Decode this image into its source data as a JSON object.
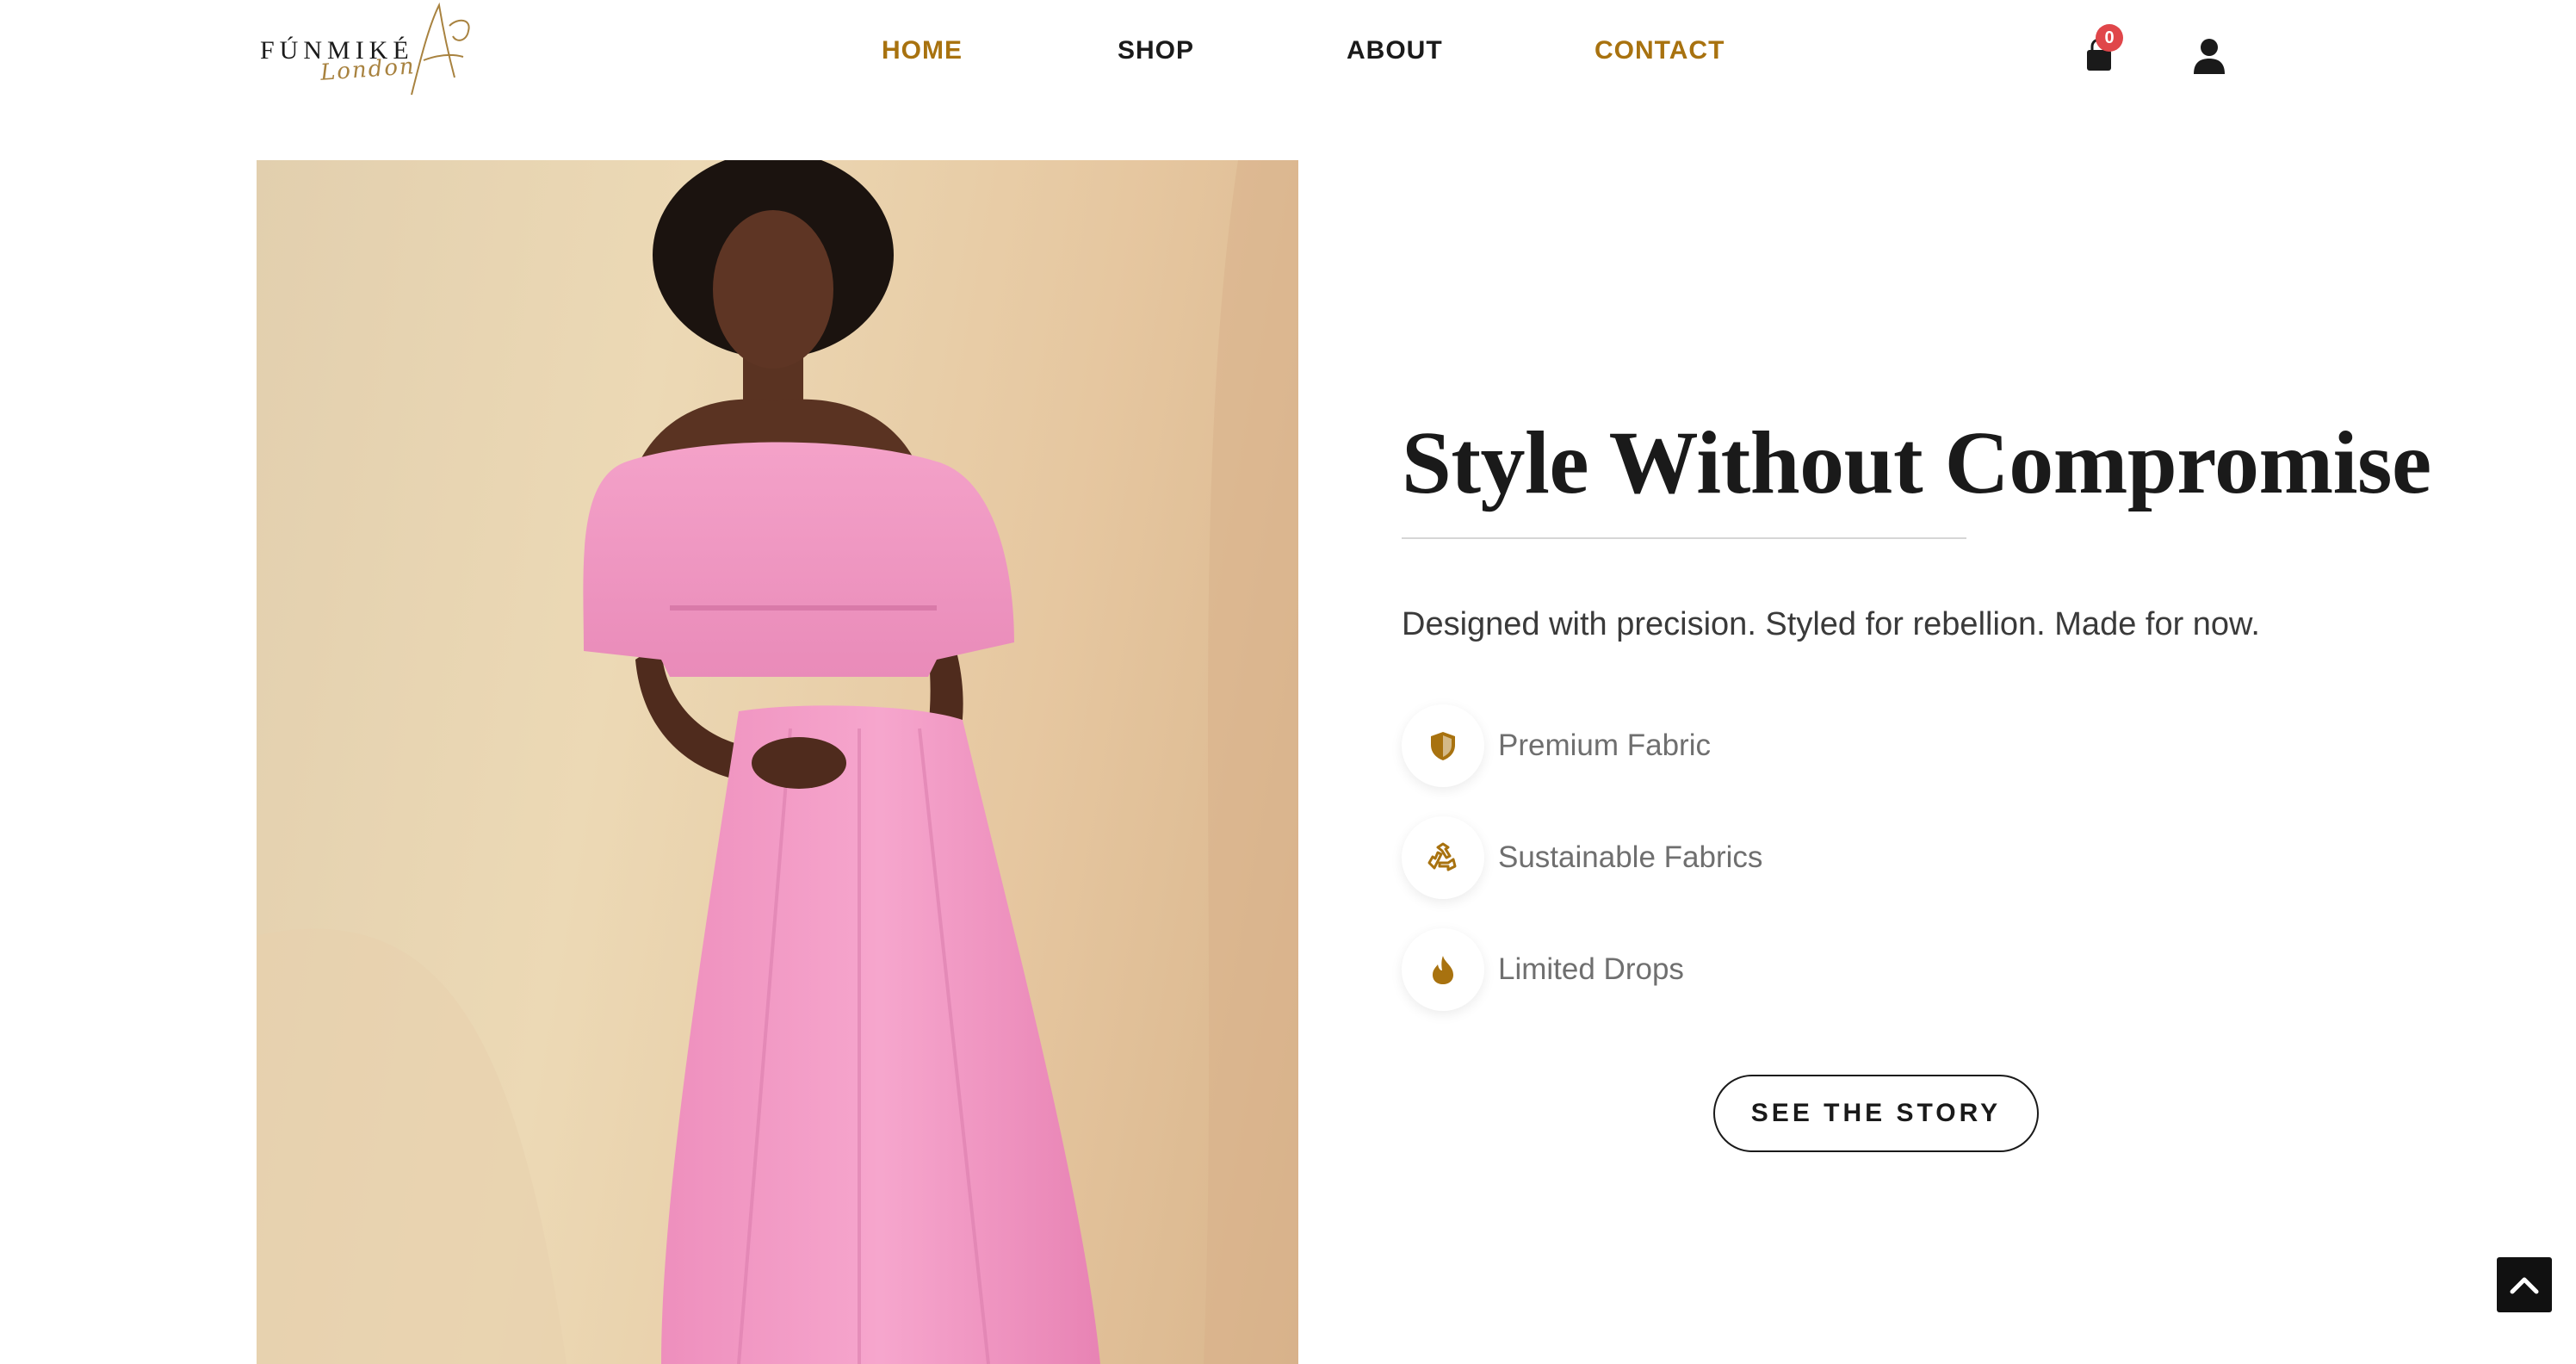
{
  "header": {
    "logo": {
      "wordmark": "FÚNMIKÉ",
      "script": "London"
    },
    "nav": [
      {
        "label": "HOME",
        "active": true
      },
      {
        "label": "SHOP",
        "active": false
      },
      {
        "label": "ABOUT",
        "active": false
      },
      {
        "label": "CONTACT",
        "active": true
      }
    ],
    "cart": {
      "icon": "shopping-bag-icon",
      "count": "0"
    },
    "account": {
      "icon": "user-icon"
    }
  },
  "hero": {
    "image_alt": "Model wearing pink off-shoulder crop top and matching maxi skirt",
    "title": "Style Without Compromise",
    "subtitle": "Designed with precision. Styled for rebellion. Made for now.",
    "features": [
      {
        "icon": "shield-icon",
        "label": "Premium Fabric"
      },
      {
        "icon": "recycle-icon",
        "label": "Sustainable Fabrics"
      },
      {
        "icon": "flame-icon",
        "label": "Limited Drops"
      }
    ],
    "cta_label": "SEE THE STORY"
  },
  "back_to_top": {
    "icon": "chevron-up-icon"
  },
  "colors": {
    "accent": "#a8720f",
    "text": "#1a1a1a",
    "muted": "#6f6f6f",
    "badge": "#e0464a",
    "dress_pink": "#f29bc6"
  }
}
